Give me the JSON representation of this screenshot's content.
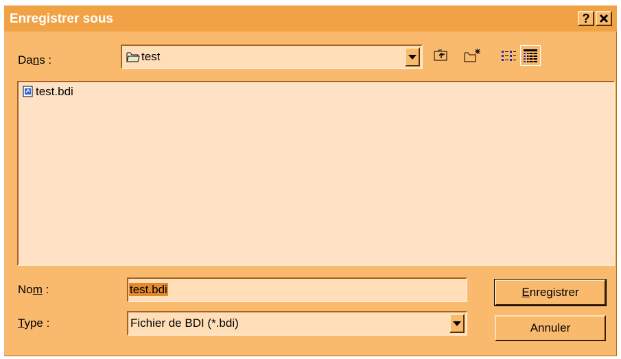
{
  "dialog": {
    "title": "Enregistrer sous",
    "help_label": "?",
    "close_label": "✕"
  },
  "location": {
    "label_pre": "Da",
    "label_ul": "n",
    "label_post": "s :",
    "current_folder": "test"
  },
  "toolbar": {
    "up_folder": "up-folder-icon",
    "new_folder": "new-folder-icon",
    "list_view": "list-view-icon",
    "details_view": "details-view-icon"
  },
  "files": [
    {
      "name": "test.bdi"
    }
  ],
  "filename": {
    "label_pre": "No",
    "label_ul": "m",
    "label_post": " :",
    "value": "test.bdi"
  },
  "filetype": {
    "label_ul": "T",
    "label_post": "ype :",
    "value": "Fichier de BDI (*.bdi)"
  },
  "buttons": {
    "save_ul": "E",
    "save_rest": "nregistrer",
    "cancel": "Annuler"
  },
  "colors": {
    "dialog_bg": "#f9ba6e",
    "title_bar": "#f0a244",
    "field_bg": "#ffdeb8",
    "selection": "#e48a2e"
  }
}
